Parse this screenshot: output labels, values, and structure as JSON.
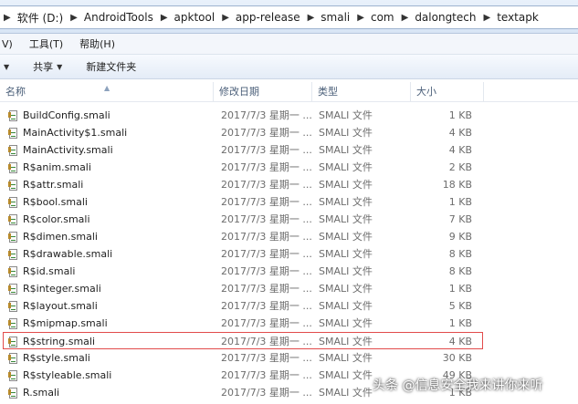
{
  "breadcrumb": [
    "软件 (D:)",
    "AndroidTools",
    "apktool",
    "app-release",
    "smali",
    "com",
    "dalongtech",
    "textapk"
  ],
  "menu": [
    "V)",
    "工具(T)",
    "帮助(H)"
  ],
  "toolbar": {
    "share": "共享",
    "new_folder": "新建文件夹"
  },
  "columns": {
    "name": "名称",
    "date": "修改日期",
    "type": "类型",
    "size": "大小"
  },
  "files": [
    {
      "name": "BuildConfig.smali",
      "date": "2017/7/3 星期一 ...",
      "type": "SMALI 文件",
      "size": "1 KB"
    },
    {
      "name": "MainActivity$1.smali",
      "date": "2017/7/3 星期一 ...",
      "type": "SMALI 文件",
      "size": "4 KB"
    },
    {
      "name": "MainActivity.smali",
      "date": "2017/7/3 星期一 ...",
      "type": "SMALI 文件",
      "size": "4 KB"
    },
    {
      "name": "R$anim.smali",
      "date": "2017/7/3 星期一 ...",
      "type": "SMALI 文件",
      "size": "2 KB"
    },
    {
      "name": "R$attr.smali",
      "date": "2017/7/3 星期一 ...",
      "type": "SMALI 文件",
      "size": "18 KB"
    },
    {
      "name": "R$bool.smali",
      "date": "2017/7/3 星期一 ...",
      "type": "SMALI 文件",
      "size": "1 KB"
    },
    {
      "name": "R$color.smali",
      "date": "2017/7/3 星期一 ...",
      "type": "SMALI 文件",
      "size": "7 KB"
    },
    {
      "name": "R$dimen.smali",
      "date": "2017/7/3 星期一 ...",
      "type": "SMALI 文件",
      "size": "9 KB"
    },
    {
      "name": "R$drawable.smali",
      "date": "2017/7/3 星期一 ...",
      "type": "SMALI 文件",
      "size": "8 KB"
    },
    {
      "name": "R$id.smali",
      "date": "2017/7/3 星期一 ...",
      "type": "SMALI 文件",
      "size": "8 KB"
    },
    {
      "name": "R$integer.smali",
      "date": "2017/7/3 星期一 ...",
      "type": "SMALI 文件",
      "size": "1 KB"
    },
    {
      "name": "R$layout.smali",
      "date": "2017/7/3 星期一 ...",
      "type": "SMALI 文件",
      "size": "5 KB"
    },
    {
      "name": "R$mipmap.smali",
      "date": "2017/7/3 星期一 ...",
      "type": "SMALI 文件",
      "size": "1 KB"
    },
    {
      "name": "R$string.smali",
      "date": "2017/7/3 星期一 ...",
      "type": "SMALI 文件",
      "size": "4 KB",
      "marked": true
    },
    {
      "name": "R$style.smali",
      "date": "2017/7/3 星期一 ...",
      "type": "SMALI 文件",
      "size": "30 KB"
    },
    {
      "name": "R$styleable.smali",
      "date": "2017/7/3 星期一 ...",
      "type": "SMALI 文件",
      "size": "49 KB"
    },
    {
      "name": "R.smali",
      "date": "2017/7/3 星期一 ...",
      "type": "SMALI 文件",
      "size": "1 KB"
    }
  ],
  "watermark": "头条 @信息安全我来讲你来听",
  "colors": {
    "highlight_border": "#e24b4b",
    "header_text": "#4c607a",
    "secondary_text": "#6d6d6d"
  }
}
